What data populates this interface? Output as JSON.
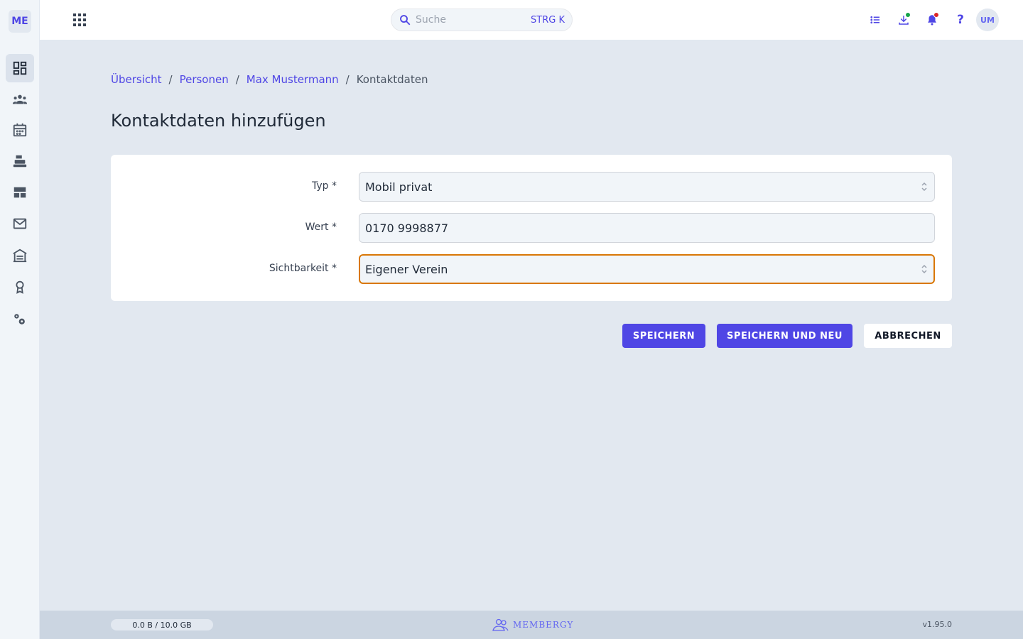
{
  "sidebar": {
    "logo": "ME",
    "items": [
      {
        "icon": "dashboard-icon",
        "active": true
      },
      {
        "icon": "people-icon"
      },
      {
        "icon": "calendar-icon"
      },
      {
        "icon": "cash-register-icon"
      },
      {
        "icon": "layout-icon"
      },
      {
        "icon": "mail-icon"
      },
      {
        "icon": "warehouse-icon"
      },
      {
        "icon": "award-icon"
      },
      {
        "icon": "settings-icon"
      }
    ]
  },
  "topbar": {
    "search_placeholder": "Suche",
    "search_shortcut": "STRG K",
    "help": "?",
    "avatar": "UM",
    "download_dot_color": "#16a34a",
    "notification_dot_color": "#dc2626"
  },
  "breadcrumb": {
    "items": [
      "Übersicht",
      "Personen",
      "Max Mustermann"
    ],
    "separator": "/",
    "current": "Kontaktdaten"
  },
  "page": {
    "title": "Kontaktdaten hinzufügen"
  },
  "form": {
    "fields": [
      {
        "label": "Typ *",
        "value": "Mobil privat",
        "type": "select"
      },
      {
        "label": "Wert *",
        "value": "0170 9998877",
        "type": "input"
      },
      {
        "label": "Sichtbarkeit *",
        "value": "Eigener Verein",
        "type": "select",
        "focused": true
      }
    ]
  },
  "actions": {
    "save": "SPEICHERN",
    "save_new": "SPEICHERN UND NEU",
    "cancel": "ABBRECHEN"
  },
  "footer": {
    "storage": "0.0 B / 10.0 GB",
    "brand": "MEMBERGY",
    "version": "v1.95.0"
  },
  "colors": {
    "accent": "#4f46e5",
    "focus": "#d97706"
  }
}
